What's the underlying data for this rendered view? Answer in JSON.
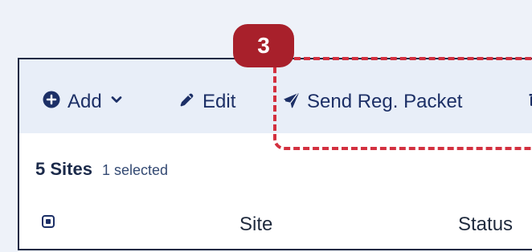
{
  "toolbar": {
    "add_label": "Add",
    "edit_label": "Edit",
    "send_label": "Send Reg. Packet"
  },
  "summary": {
    "count_label": "5 Sites",
    "selected_label": "1 selected"
  },
  "table": {
    "headers": [
      "Site",
      "Status"
    ]
  },
  "step_badge": {
    "number": "3"
  },
  "colors": {
    "panel_border": "#1d2a44",
    "toolbar_background": "#e8eef8",
    "accent_red": "#a8202b",
    "dash_red": "#d3303f",
    "primary_blue": "#1c2f66"
  },
  "icons": {
    "add": "plus-circle-icon",
    "add_menu": "chevron-down-icon",
    "edit": "pencil-icon",
    "send": "paper-plane-icon",
    "delete": "trash-icon",
    "select_all": "checkbox-icon"
  }
}
